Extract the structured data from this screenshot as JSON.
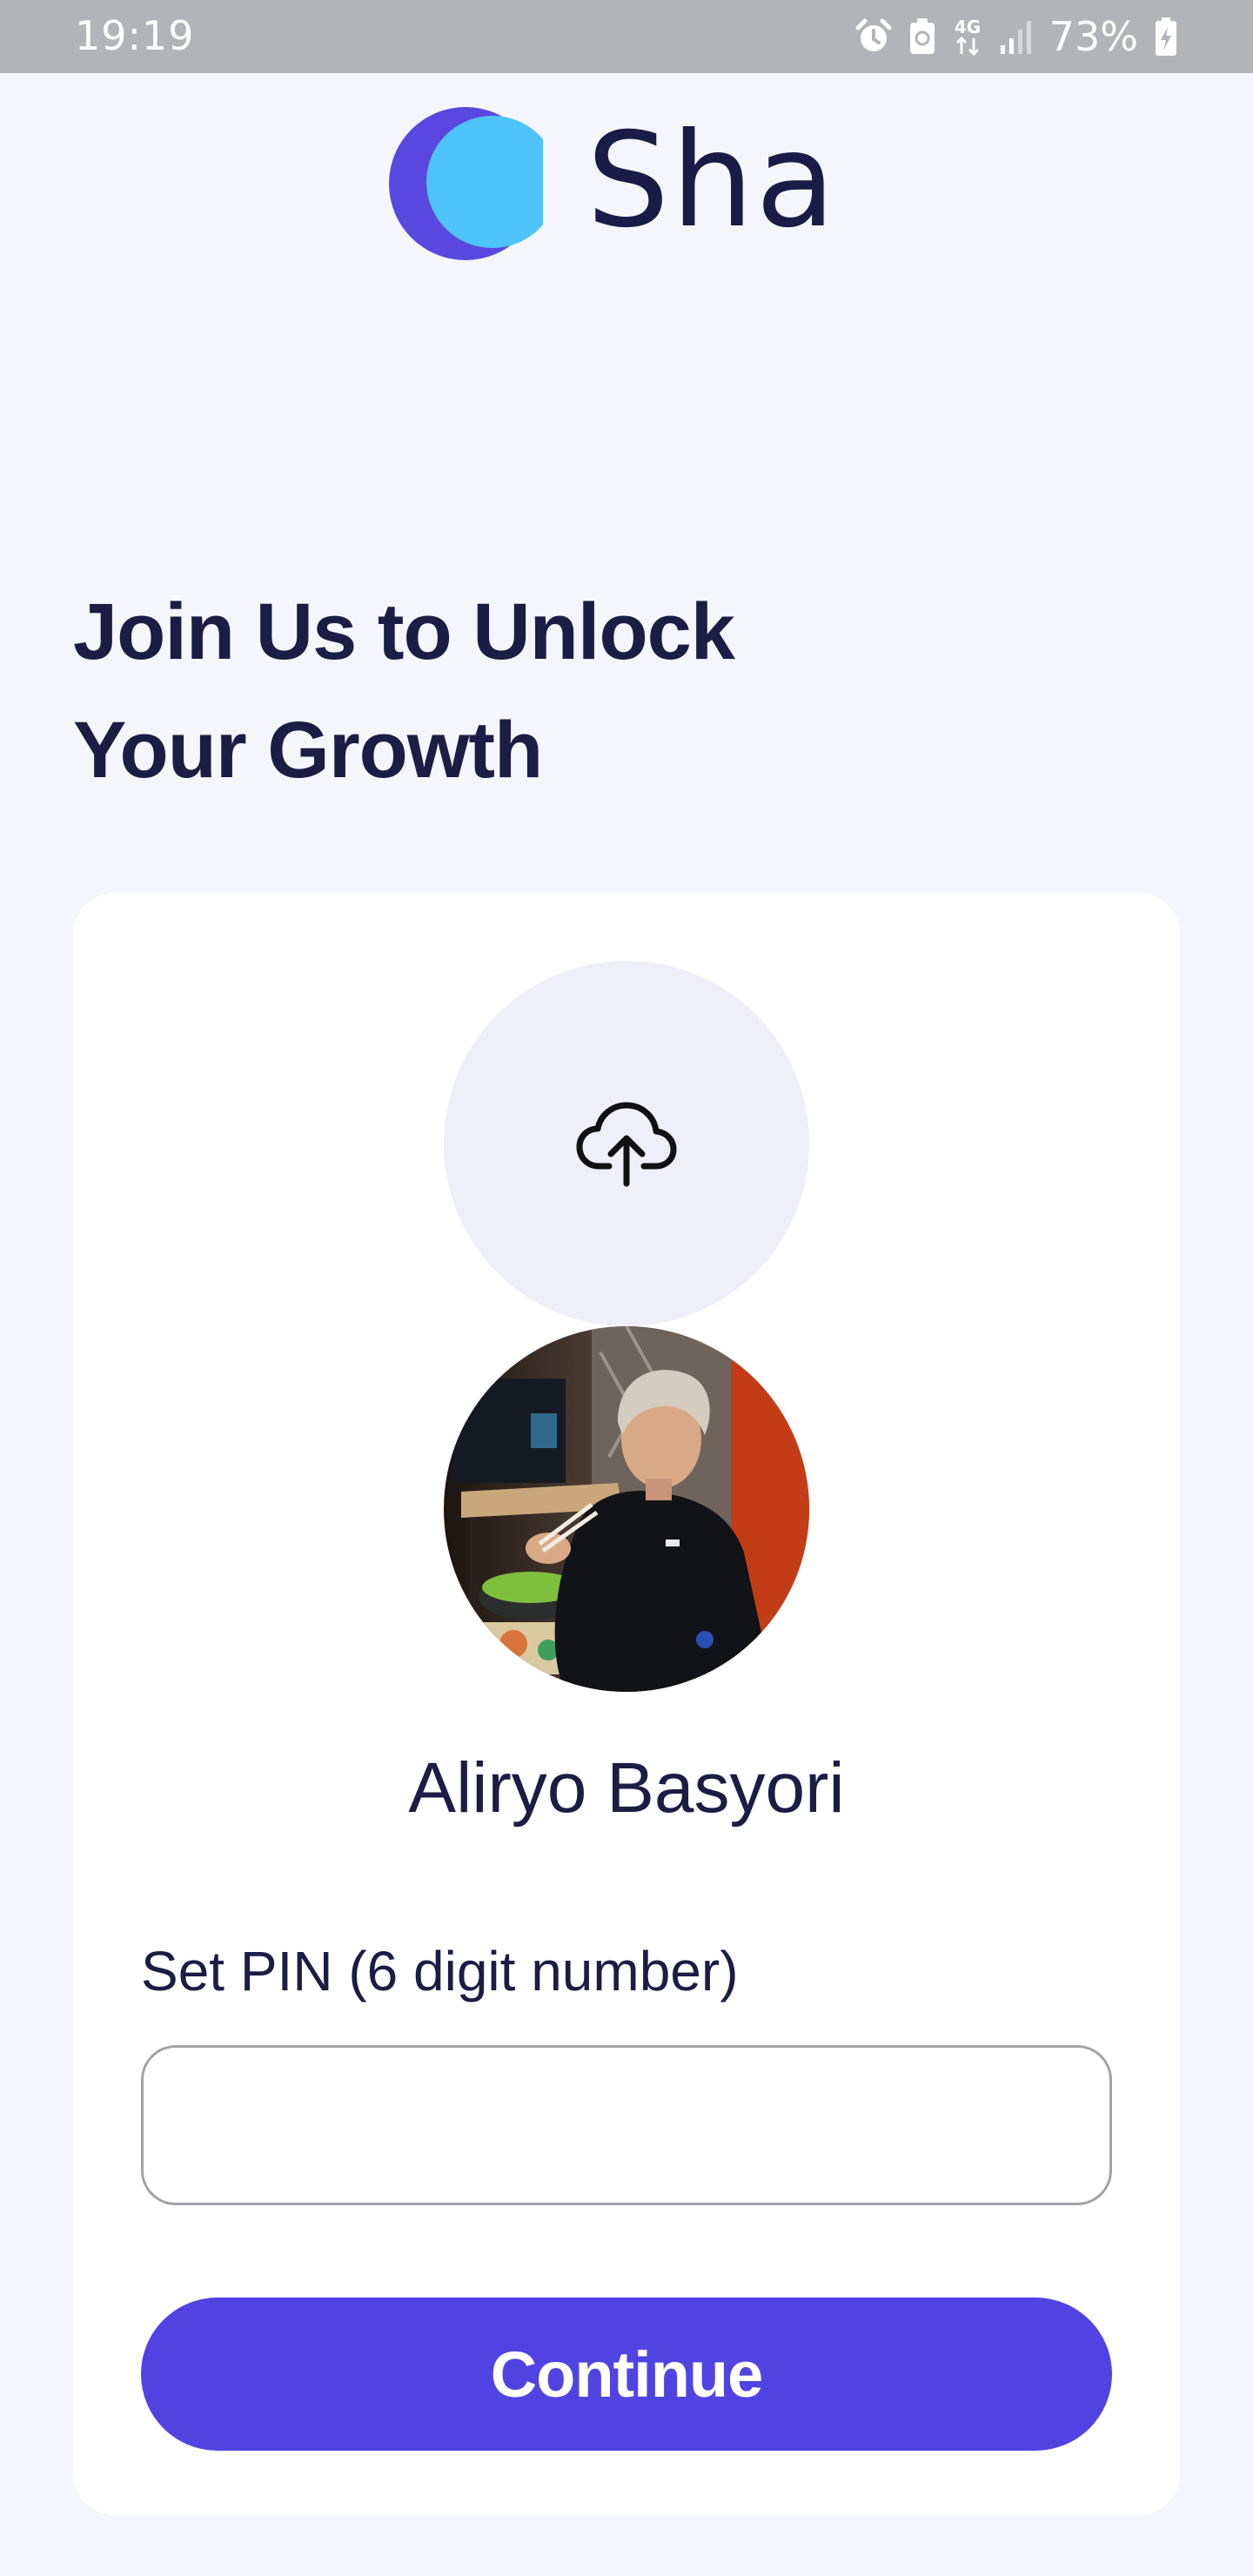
{
  "status_bar": {
    "time": "19:19",
    "battery": "73%",
    "network": "4G",
    "icons": [
      "alarm-icon",
      "battery-saver-icon",
      "network-4g-icon",
      "signal-icon",
      "battery-charging-icon"
    ]
  },
  "brand": {
    "name": "Sha",
    "logo_icon": "crescent-moon-logo-icon",
    "colors": {
      "mark_back": "#5a47e0",
      "mark_front": "#4fc3fb",
      "text": "#1a1c47"
    }
  },
  "headline": {
    "line1": "Join Us to Unlock",
    "line2": "Your Growth"
  },
  "form": {
    "upload_icon": "cloud-upload-icon",
    "user_name": "Aliryo Basyori",
    "pin_label": "Set PIN (6 digit number)",
    "pin_value": "",
    "pin_placeholder": "",
    "continue_label": "Continue"
  },
  "colors": {
    "accent": "#5143e2",
    "background": "#f5f6fb",
    "card": "#ffffff",
    "upload_circle": "#efeff7"
  }
}
